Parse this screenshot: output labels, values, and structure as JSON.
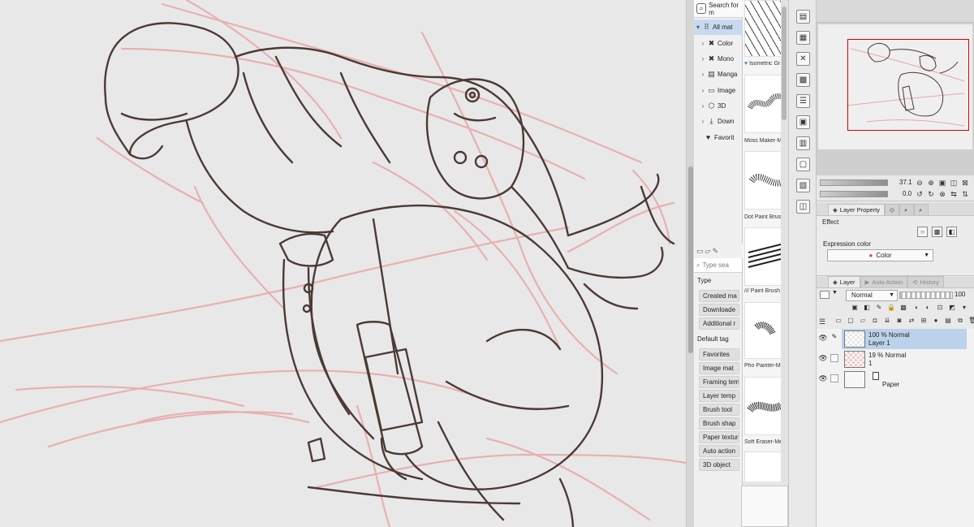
{
  "material_tree": {
    "search_label": "Search for m",
    "items": [
      {
        "label": "All mat",
        "chevron": "▾",
        "icon": "grid-icon",
        "selected": true
      },
      {
        "label": "Color",
        "chevron": "›",
        "icon": "color-x-icon"
      },
      {
        "label": "Mono",
        "chevron": "›",
        "icon": "mono-x-icon"
      },
      {
        "label": "Manga",
        "chevron": "›",
        "icon": "manga-icon"
      },
      {
        "label": "Image",
        "chevron": "›",
        "icon": "image-icon"
      },
      {
        "label": "3D",
        "chevron": "›",
        "icon": "cube-icon"
      },
      {
        "label": "Down",
        "chevron": "›",
        "icon": "download-icon"
      },
      {
        "label": "Favorit",
        "chevron": "",
        "icon": "heart-icon"
      }
    ]
  },
  "tag_panel": {
    "search_placeholder": "Type sea",
    "type_heading": "Type",
    "type_tags": [
      "Created ma",
      "Downloade",
      "Additional r"
    ],
    "default_heading": "Default tag",
    "default_tags": [
      "Favorites",
      "Image mat",
      "Framing tem",
      "Layer temp",
      "Brush tool",
      "Brush shap",
      "Paper textur",
      "Auto action",
      "3D object"
    ]
  },
  "material_list": {
    "items": [
      {
        "label": "Isometric Gr",
        "favorite": true
      },
      {
        "label": "Moss Maker-M",
        "favorite": false
      },
      {
        "label": "Dot Paint Brush",
        "favorite": false
      },
      {
        "label": "/// Paint Brush",
        "favorite": false
      },
      {
        "label": "Pho Painter-Me",
        "favorite": false
      },
      {
        "label": "Soft Eraser-Me",
        "favorite": false
      }
    ]
  },
  "navigator": {
    "zoom_value": "37.1",
    "rotation_value": "0.0"
  },
  "layer_property": {
    "tabs": [
      "Layer Property"
    ],
    "effect_label": "Effect",
    "expression_label": "Expression color",
    "expression_value": "Color"
  },
  "layer_panel": {
    "tabs": [
      "Layer",
      "Auto Action",
      "History"
    ],
    "blend_mode": "Normal",
    "opacity": "100",
    "layers": [
      {
        "line1": "100 % Normal",
        "line2": "Layer 1",
        "selected": true,
        "thumb": "checker"
      },
      {
        "line1": "19 % Normal",
        "line2": "1",
        "selected": false,
        "thumb": "pink"
      },
      {
        "line1": "",
        "line2": "Paper",
        "selected": false,
        "thumb": "paper"
      }
    ]
  },
  "colors": {
    "selection": "#bcd2ea",
    "navigator_frame": "#d40000",
    "lineart": "#4a3a34",
    "sketch": "#e8a7a7"
  }
}
